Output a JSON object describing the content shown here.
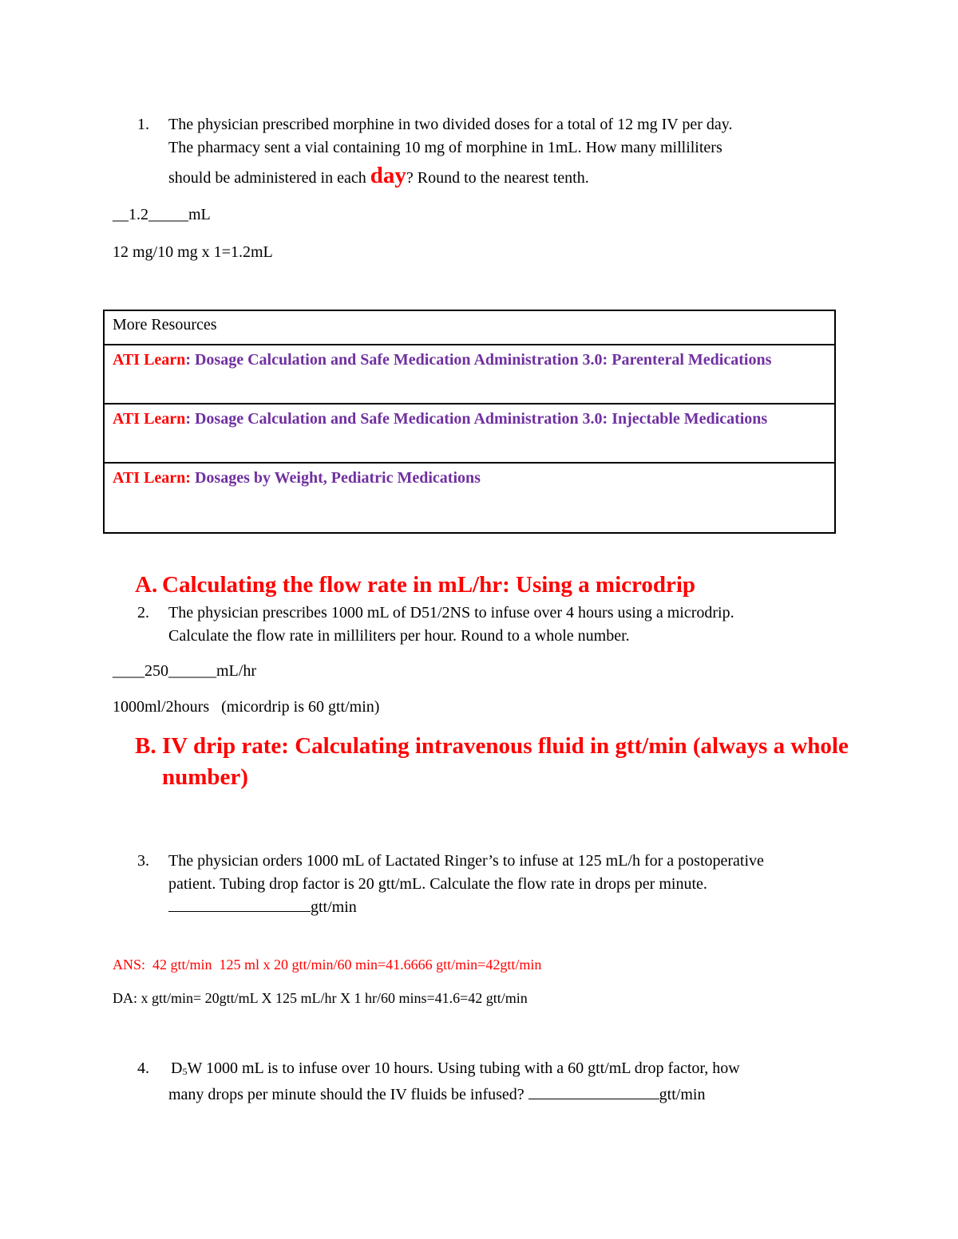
{
  "questions": {
    "q1": {
      "number": "1.",
      "line1": "The physician prescribed morphine in two divided doses for a total of 12 mg IV per day.",
      "line2": "The pharmacy sent a vial containing 10 mg of morphine in 1mL. How many milliliters",
      "line3_pre": "should be administered in each ",
      "line3_emph": "day",
      "line3_post": "? Round to the nearest tenth.",
      "answer_line": "__1.2_____mL",
      "work": "12 mg/10 mg x 1=1.2mL"
    },
    "q2": {
      "number": "2.",
      "line1": "The physician prescribes 1000 mL of D51/2NS to infuse over 4 hours using a microdrip.",
      "line2": "Calculate the flow rate in milliliters per hour. Round to a whole number.",
      "answer_line": "____250______mL/hr",
      "work": "1000ml/2hours   (micordrip is 60 gtt/min)"
    },
    "q3": {
      "number": "3.",
      "line1": "The physician orders 1000 mL of Lactated Ringer’s to infuse at 125 mL/h for a postoperative",
      "line2": "patient. Tubing drop factor is 20 gtt/mL. Calculate the flow rate in drops per minute.",
      "unit": "gtt/min",
      "ans": "ANS:  42 gtt/min  125 ml x 20 gtt/min/60 min=41.6666 gtt/min=42gtt/min",
      "da": "DA: x gtt/min= 20gtt/mL X 125 mL/hr X 1 hr/60 mins=41.6=42 gtt/min"
    },
    "q4": {
      "number": "4.",
      "line1_d": "D",
      "line1_sub": "5",
      "line1_rest": "W 1000 mL is to infuse over 10 hours. Using tubing with a 60 gtt/mL drop factor, how",
      "line2": "many drops per minute should the IV fluids be infused? ",
      "unit": "gtt/min"
    }
  },
  "resources": {
    "header": "More Resources",
    "items": [
      {
        "prefix": "ATI Learn",
        "sep": ": ",
        "title": "Dosage Calculation and Safe Medication Administration 3.0: Parenteral Medications"
      },
      {
        "prefix": "ATI Learn",
        "sep": ": ",
        "title": "Dosage Calculation and Safe Medication Administration 3.0: Injectable Medications"
      },
      {
        "prefix": "ATI Learn:",
        "sep": " ",
        "title": "Dosages by Weight, Pediatric Medications"
      }
    ]
  },
  "sections": {
    "a": {
      "letter": "A.",
      "title": "Calculating the flow rate in mL/hr: Using a microdrip"
    },
    "b": {
      "letter": "B.",
      "title": "IV drip rate: Calculating intravenous fluid in gtt/min (always a whole number)"
    }
  },
  "colors": {
    "accent_red": "#ff0000",
    "link_purple": "#7030a0",
    "text": "#000000"
  }
}
